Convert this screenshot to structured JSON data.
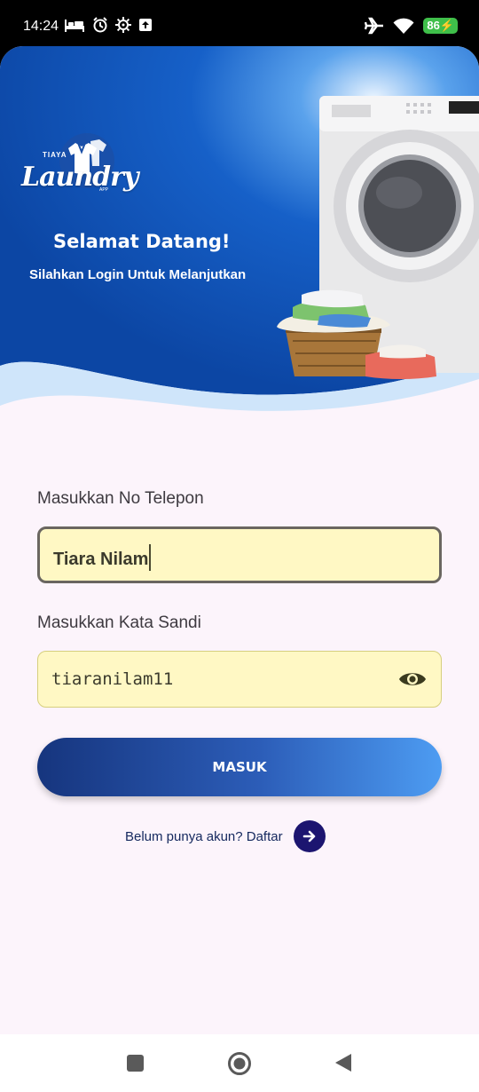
{
  "status_bar": {
    "time": "14:24",
    "battery": "86",
    "left_icons": [
      "bed-icon",
      "alarm-icon",
      "gear-icon",
      "upload-icon"
    ],
    "right_icons": [
      "airplane-icon",
      "wifi-icon",
      "battery-icon"
    ]
  },
  "brand": {
    "small_top": "TIAYA",
    "script": "Laundry",
    "small_bottom": "APP",
    "colors": {
      "primary": "#0d47a1",
      "accent": "#4d9cf2",
      "field_bg": "#fff8c4"
    }
  },
  "header": {
    "title": "Selamat Datang!",
    "subtitle": "Silahkan Login Untuk Melanjutkan"
  },
  "form": {
    "phone_label": "Masukkan No Telepon",
    "phone_value": "Tiara Nilam",
    "password_label": "Masukkan Kata Sandi",
    "password_value": "tiaranilam11",
    "password_icon": "eye-icon",
    "submit_label": "MASUK"
  },
  "register": {
    "text": "Belum punya akun? Daftar",
    "icon": "arrow-right-icon"
  },
  "nav": {
    "items": [
      "recent-apps-button",
      "home-button",
      "back-button"
    ]
  }
}
